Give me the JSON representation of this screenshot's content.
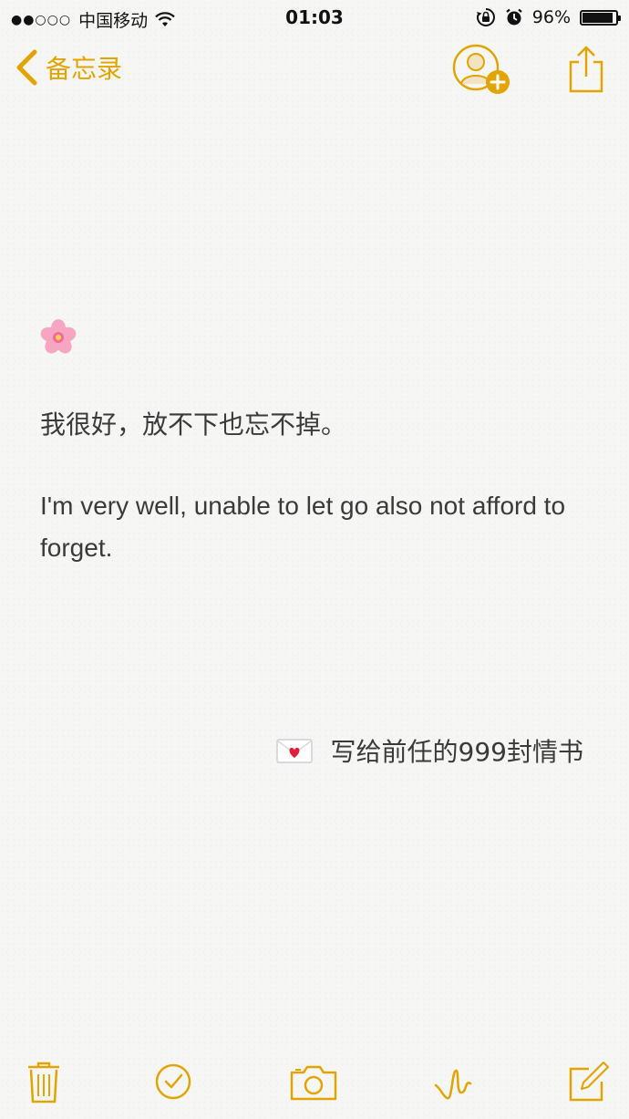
{
  "status_bar": {
    "signal": "●●○○○",
    "carrier": "中国移动",
    "time": "01:03",
    "battery_percent_label": "96%",
    "battery_level": 0.96,
    "icons": [
      "wifi-icon",
      "rotation-lock-icon",
      "alarm-icon",
      "battery-icon"
    ]
  },
  "nav": {
    "back_label": "备忘录",
    "icons": [
      "chevron-left-icon",
      "add-person-icon",
      "share-icon"
    ],
    "accent_color": "#e2a400"
  },
  "note": {
    "emoji_top": "cherry-blossom-icon",
    "line_cn": "我很好，放不下也忘不掉。",
    "line_en": "I'm very well, unable to let go also not afford to forget.",
    "signature_icon": "love-letter-icon",
    "signature": "写给前任的999封情书"
  },
  "toolbar": {
    "icons": [
      "trash-icon",
      "checklist-icon",
      "camera-icon",
      "sketch-icon",
      "compose-icon"
    ]
  }
}
